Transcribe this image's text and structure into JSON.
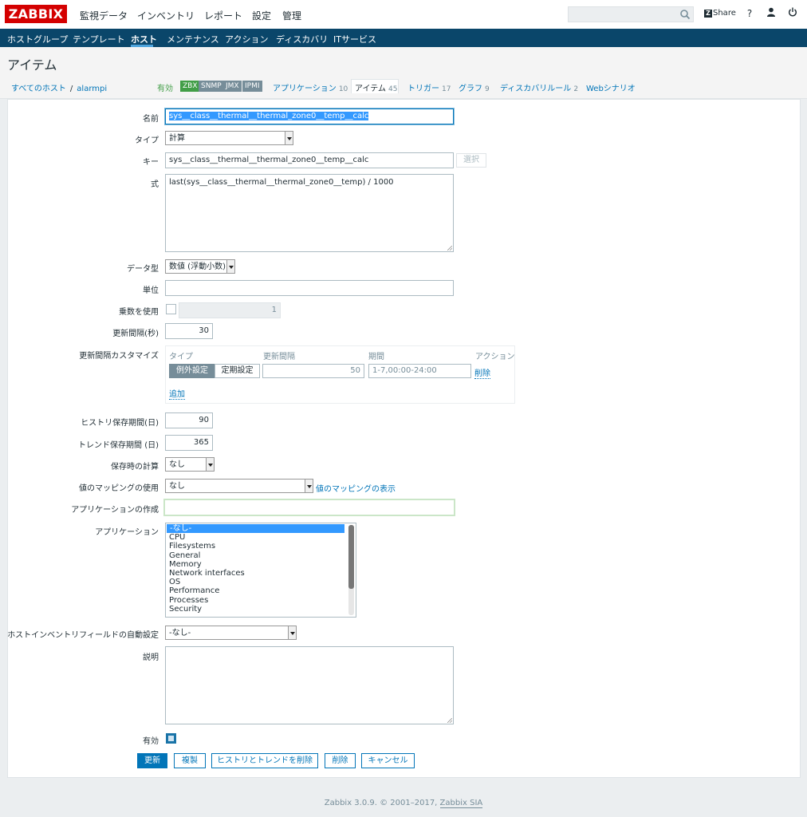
{
  "brand": {
    "logo": "ZABBIX"
  },
  "main_nav": [
    "監視データ",
    "インベントリ",
    "レポート",
    "設定",
    "管理"
  ],
  "header_tools": {
    "search_value": "",
    "share": "Share",
    "help": "?"
  },
  "sub_nav": [
    "ホストグループ",
    "テンプレート",
    "ホスト",
    "メンテナンス",
    "アクション",
    "ディスカバリ",
    "ITサービス"
  ],
  "page": {
    "title": "アイテム"
  },
  "breadcrumb": {
    "all_hosts": "すべてのホスト",
    "sep": "/",
    "host": "alarmpi"
  },
  "host_status": {
    "enabled": "有効",
    "badges": [
      "ZBX",
      "SNMP",
      "JMX",
      "IPMI"
    ]
  },
  "host_tabs": [
    {
      "label": "アプリケーション",
      "count": "10"
    },
    {
      "label": "アイテム",
      "count": "45"
    },
    {
      "label": "トリガー",
      "count": "17"
    },
    {
      "label": "グラフ",
      "count": "9"
    },
    {
      "label": "ディスカバリルール",
      "count": "2"
    },
    {
      "label": "Webシナリオ",
      "count": ""
    }
  ],
  "form": {
    "labels": {
      "name": "名前",
      "type": "タイプ",
      "key": "キー",
      "formula": "式",
      "data_type": "データ型",
      "units": "単位",
      "multiplier": "乗数を使用",
      "interval": "更新間隔(秒)",
      "custom_intervals": "更新間隔カスタマイズ",
      "history": "ヒストリ保存期間(日)",
      "trends": "トレンド保存期間 (日)",
      "store_value": "保存時の計算",
      "value_map": "値のマッピングの使用",
      "new_application": "アプリケーションの作成",
      "applications": "アプリケーション",
      "inventory": "ホストインベントリフィールドの自動設定",
      "description": "説明",
      "enabled": "有効"
    },
    "values": {
      "name": "sys__class__thermal__thermal_zone0__temp__calc",
      "type": "計算",
      "key": "sys__class__thermal__thermal_zone0__temp__calc",
      "key_select_button": "選択",
      "formula": "last(sys__class__thermal__thermal_zone0__temp) / 1000",
      "data_type": "数値 (浮動小数)",
      "units": "",
      "multiplier_enabled": false,
      "multiplier": "1",
      "interval": "30",
      "history": "90",
      "trends": "365",
      "store_value": "なし",
      "value_map": "なし",
      "value_map_link": "値のマッピングの表示",
      "new_application": "",
      "inventory": "-なし-",
      "description": "",
      "enabled": true
    },
    "custom_intervals": {
      "headers": [
        "タイプ",
        "更新間隔",
        "期間",
        "アクション"
      ],
      "row": {
        "type_options": [
          "例外設定",
          "定期設定"
        ],
        "active_type": "例外設定",
        "interval": "50",
        "period": "1-7,00:00-24:00",
        "remove": "削除"
      },
      "add": "追加"
    },
    "applications_list": [
      "-なし-",
      "CPU",
      "Filesystems",
      "General",
      "Memory",
      "Network interfaces",
      "OS",
      "Performance",
      "Processes",
      "Security"
    ],
    "applications_selected": "-なし-",
    "buttons": {
      "update": "更新",
      "clone": "複製",
      "clear_history": "ヒストリとトレンドを削除",
      "delete": "削除",
      "cancel": "キャンセル"
    }
  },
  "footer": {
    "text": "Zabbix 3.0.9. © 2001–2017, ",
    "link": "Zabbix SIA"
  },
  "colors": {
    "brand_red": "#d40000",
    "nav_dark": "#0a466a",
    "link_blue": "#0275b8",
    "enabled_green": "#429e47",
    "zbx_green": "#429e47",
    "badge_gray": "#768d99"
  }
}
